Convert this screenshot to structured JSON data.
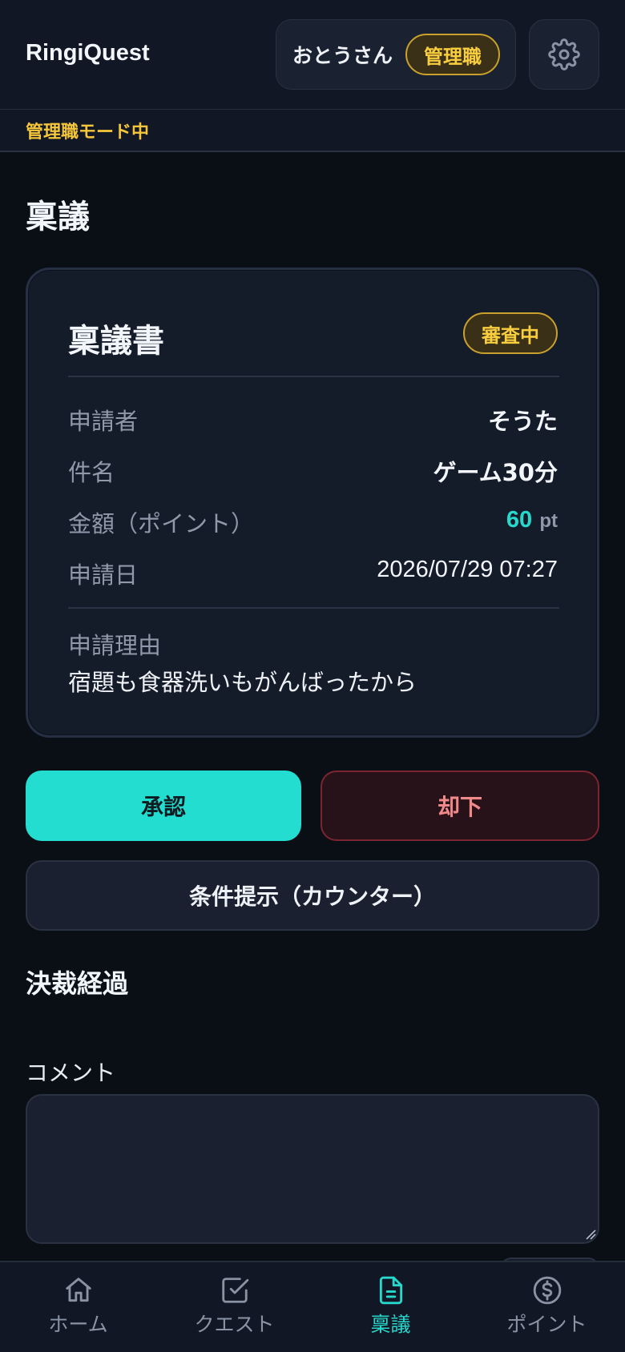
{
  "header": {
    "app_title": "RingiQuest",
    "user_name": "おとうさん",
    "role_badge": "管理職",
    "settings_icon": "gear-icon"
  },
  "mode_bar": {
    "text": "管理職モード中"
  },
  "page": {
    "title": "稟議"
  },
  "card": {
    "title": "稟議書",
    "status": "審査中",
    "rows": {
      "applicant": {
        "label": "申請者",
        "value": "そうた"
      },
      "subject": {
        "label": "件名",
        "value": "ゲーム30分"
      },
      "amount": {
        "label": "金額（ポイント）",
        "value": "60",
        "unit": "pt"
      },
      "date": {
        "label": "申請日",
        "value": "2026/07/29 07:27"
      }
    },
    "reason": {
      "label": "申請理由",
      "value": "宿題も食器洗いもがんばったから"
    }
  },
  "actions": {
    "approve": "承認",
    "reject": "却下",
    "counter": "条件提示（カウンター）"
  },
  "history": {
    "title": "決裁経過"
  },
  "comment": {
    "label": "コメント",
    "value": ""
  },
  "nav": {
    "items": [
      {
        "label": "ホーム",
        "icon": "home-icon",
        "active": false
      },
      {
        "label": "クエスト",
        "icon": "checkbox-icon",
        "active": false
      },
      {
        "label": "稟議",
        "icon": "document-icon",
        "active": true
      },
      {
        "label": "ポイント",
        "icon": "coin-icon",
        "active": false
      }
    ]
  },
  "colors": {
    "accent": "#22ddd0",
    "warning": "#f8cd3e",
    "danger": "#f08a8a",
    "background": "#0a0e15"
  }
}
